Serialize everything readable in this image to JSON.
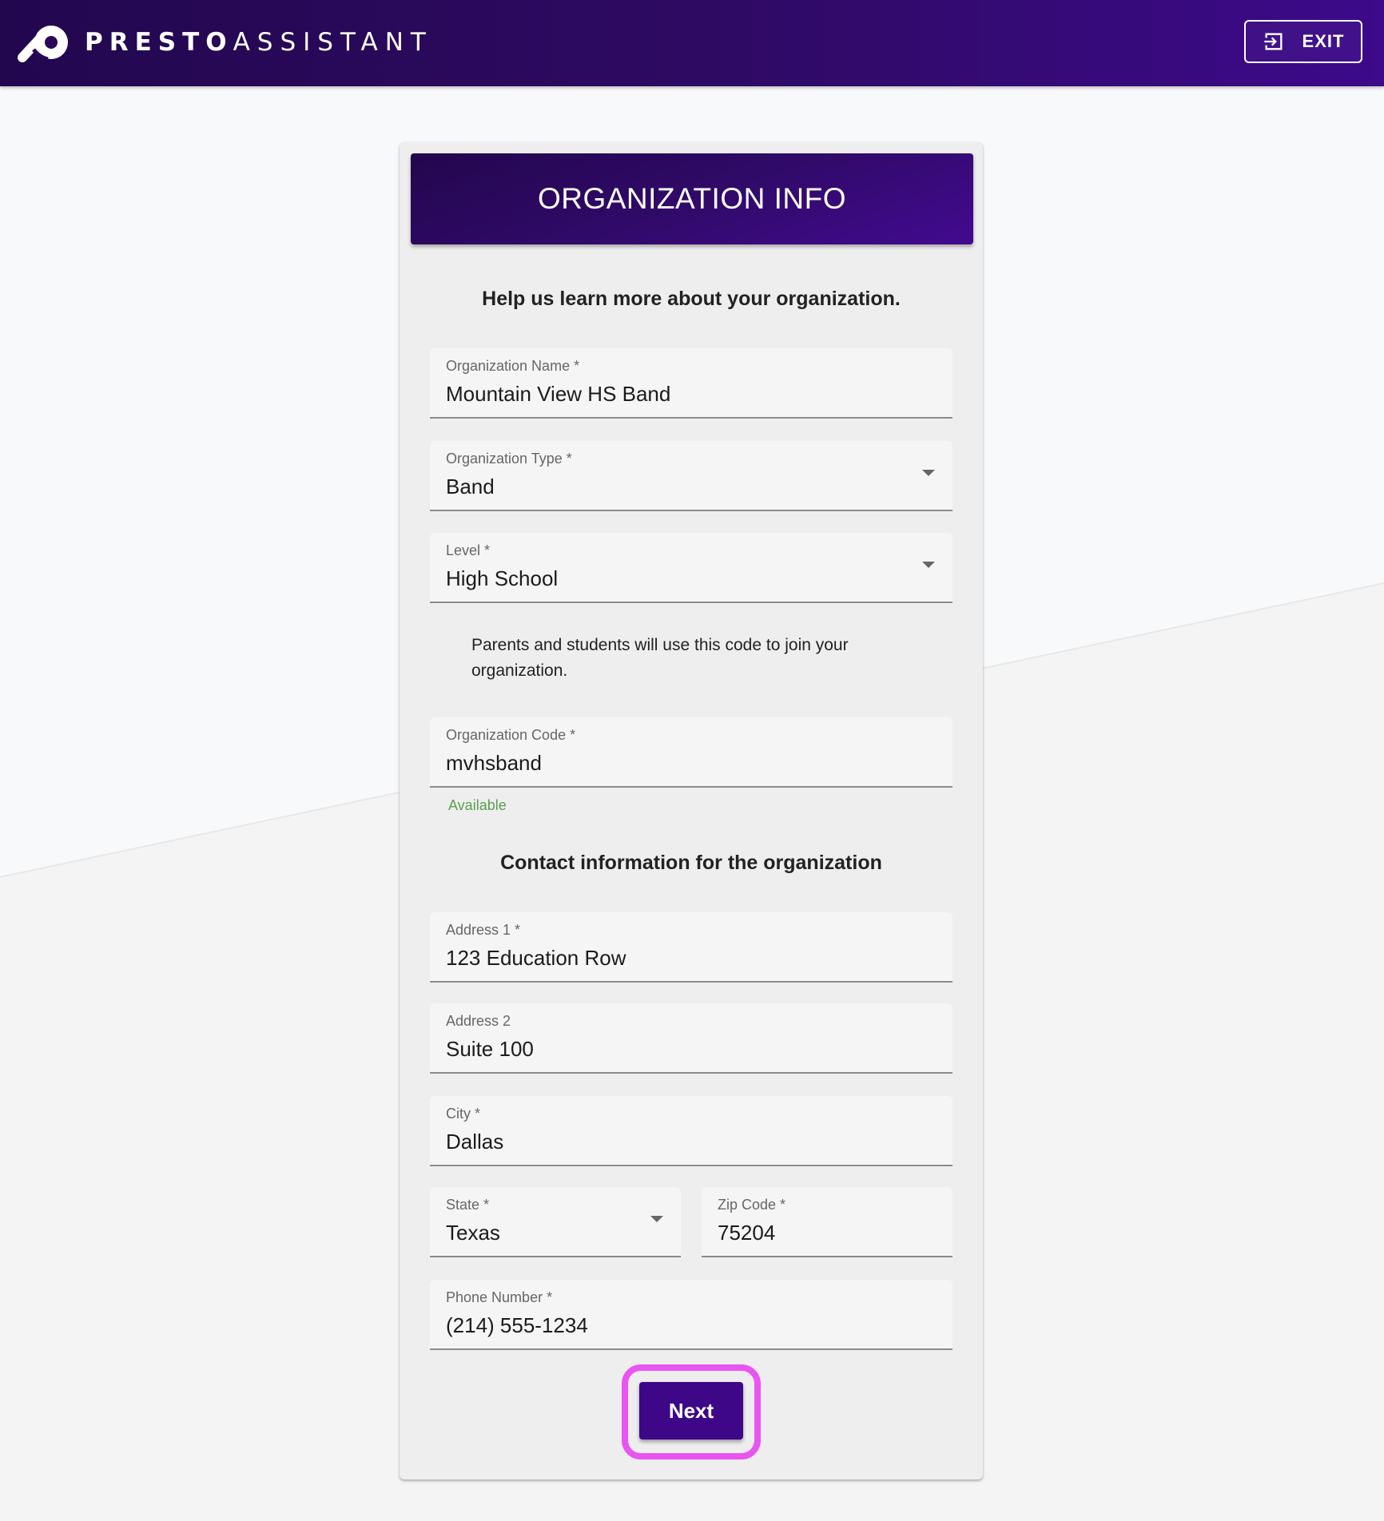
{
  "app": {
    "logo_bold": "PRESTO",
    "logo_light": "ASSISTANT",
    "exit_label": "EXIT"
  },
  "card": {
    "title": "ORGANIZATION INFO",
    "intro": "Help us learn more about your organization.",
    "code_note": "Parents and students will use this code to join your organization.",
    "code_status": "Available",
    "contact_heading": "Contact information for the organization",
    "next_label": "Next"
  },
  "fields": {
    "org_name": {
      "label": "Organization Name *",
      "value": "Mountain View HS Band"
    },
    "org_type": {
      "label": "Organization Type *",
      "value": "Band"
    },
    "level": {
      "label": "Level *",
      "value": "High School"
    },
    "org_code": {
      "label": "Organization Code *",
      "value": "mvhsband"
    },
    "address1": {
      "label": "Address 1 *",
      "value": "123 Education Row"
    },
    "address2": {
      "label": "Address 2",
      "value": "Suite 100"
    },
    "city": {
      "label": "City *",
      "value": "Dallas"
    },
    "state": {
      "label": "State *",
      "value": "Texas"
    },
    "zip": {
      "label": "Zip Code *",
      "value": "75204"
    },
    "phone": {
      "label": "Phone Number *",
      "value": "(214) 555-1234"
    }
  },
  "colors": {
    "brand_purple": "#3d0788",
    "highlight": "#e855f0",
    "available_green": "#5b9f4e"
  }
}
